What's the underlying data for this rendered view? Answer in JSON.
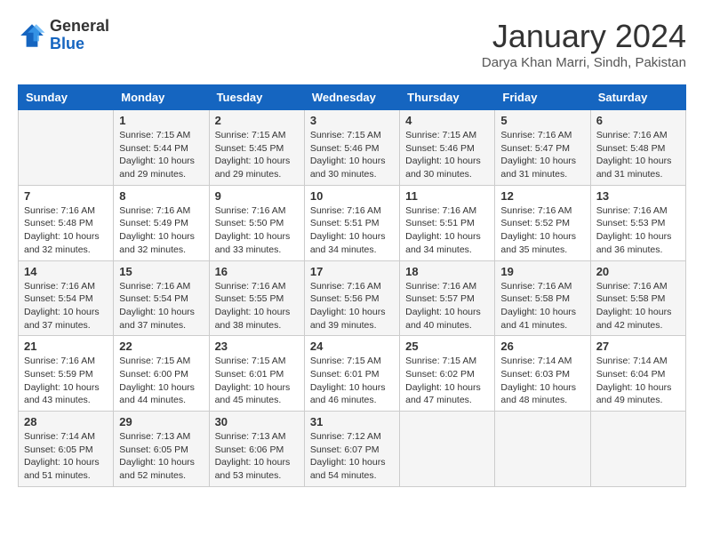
{
  "header": {
    "logo_general": "General",
    "logo_blue": "Blue",
    "month_title": "January 2024",
    "location": "Darya Khan Marri, Sindh, Pakistan"
  },
  "weekdays": [
    "Sunday",
    "Monday",
    "Tuesday",
    "Wednesday",
    "Thursday",
    "Friday",
    "Saturday"
  ],
  "weeks": [
    [
      {
        "day": "",
        "sunrise": "",
        "sunset": "",
        "daylight": ""
      },
      {
        "day": "1",
        "sunrise": "Sunrise: 7:15 AM",
        "sunset": "Sunset: 5:44 PM",
        "daylight": "Daylight: 10 hours and 29 minutes."
      },
      {
        "day": "2",
        "sunrise": "Sunrise: 7:15 AM",
        "sunset": "Sunset: 5:45 PM",
        "daylight": "Daylight: 10 hours and 29 minutes."
      },
      {
        "day": "3",
        "sunrise": "Sunrise: 7:15 AM",
        "sunset": "Sunset: 5:46 PM",
        "daylight": "Daylight: 10 hours and 30 minutes."
      },
      {
        "day": "4",
        "sunrise": "Sunrise: 7:15 AM",
        "sunset": "Sunset: 5:46 PM",
        "daylight": "Daylight: 10 hours and 30 minutes."
      },
      {
        "day": "5",
        "sunrise": "Sunrise: 7:16 AM",
        "sunset": "Sunset: 5:47 PM",
        "daylight": "Daylight: 10 hours and 31 minutes."
      },
      {
        "day": "6",
        "sunrise": "Sunrise: 7:16 AM",
        "sunset": "Sunset: 5:48 PM",
        "daylight": "Daylight: 10 hours and 31 minutes."
      }
    ],
    [
      {
        "day": "7",
        "sunrise": "Sunrise: 7:16 AM",
        "sunset": "Sunset: 5:48 PM",
        "daylight": "Daylight: 10 hours and 32 minutes."
      },
      {
        "day": "8",
        "sunrise": "Sunrise: 7:16 AM",
        "sunset": "Sunset: 5:49 PM",
        "daylight": "Daylight: 10 hours and 32 minutes."
      },
      {
        "day": "9",
        "sunrise": "Sunrise: 7:16 AM",
        "sunset": "Sunset: 5:50 PM",
        "daylight": "Daylight: 10 hours and 33 minutes."
      },
      {
        "day": "10",
        "sunrise": "Sunrise: 7:16 AM",
        "sunset": "Sunset: 5:51 PM",
        "daylight": "Daylight: 10 hours and 34 minutes."
      },
      {
        "day": "11",
        "sunrise": "Sunrise: 7:16 AM",
        "sunset": "Sunset: 5:51 PM",
        "daylight": "Daylight: 10 hours and 34 minutes."
      },
      {
        "day": "12",
        "sunrise": "Sunrise: 7:16 AM",
        "sunset": "Sunset: 5:52 PM",
        "daylight": "Daylight: 10 hours and 35 minutes."
      },
      {
        "day": "13",
        "sunrise": "Sunrise: 7:16 AM",
        "sunset": "Sunset: 5:53 PM",
        "daylight": "Daylight: 10 hours and 36 minutes."
      }
    ],
    [
      {
        "day": "14",
        "sunrise": "Sunrise: 7:16 AM",
        "sunset": "Sunset: 5:54 PM",
        "daylight": "Daylight: 10 hours and 37 minutes."
      },
      {
        "day": "15",
        "sunrise": "Sunrise: 7:16 AM",
        "sunset": "Sunset: 5:54 PM",
        "daylight": "Daylight: 10 hours and 37 minutes."
      },
      {
        "day": "16",
        "sunrise": "Sunrise: 7:16 AM",
        "sunset": "Sunset: 5:55 PM",
        "daylight": "Daylight: 10 hours and 38 minutes."
      },
      {
        "day": "17",
        "sunrise": "Sunrise: 7:16 AM",
        "sunset": "Sunset: 5:56 PM",
        "daylight": "Daylight: 10 hours and 39 minutes."
      },
      {
        "day": "18",
        "sunrise": "Sunrise: 7:16 AM",
        "sunset": "Sunset: 5:57 PM",
        "daylight": "Daylight: 10 hours and 40 minutes."
      },
      {
        "day": "19",
        "sunrise": "Sunrise: 7:16 AM",
        "sunset": "Sunset: 5:58 PM",
        "daylight": "Daylight: 10 hours and 41 minutes."
      },
      {
        "day": "20",
        "sunrise": "Sunrise: 7:16 AM",
        "sunset": "Sunset: 5:58 PM",
        "daylight": "Daylight: 10 hours and 42 minutes."
      }
    ],
    [
      {
        "day": "21",
        "sunrise": "Sunrise: 7:16 AM",
        "sunset": "Sunset: 5:59 PM",
        "daylight": "Daylight: 10 hours and 43 minutes."
      },
      {
        "day": "22",
        "sunrise": "Sunrise: 7:15 AM",
        "sunset": "Sunset: 6:00 PM",
        "daylight": "Daylight: 10 hours and 44 minutes."
      },
      {
        "day": "23",
        "sunrise": "Sunrise: 7:15 AM",
        "sunset": "Sunset: 6:01 PM",
        "daylight": "Daylight: 10 hours and 45 minutes."
      },
      {
        "day": "24",
        "sunrise": "Sunrise: 7:15 AM",
        "sunset": "Sunset: 6:01 PM",
        "daylight": "Daylight: 10 hours and 46 minutes."
      },
      {
        "day": "25",
        "sunrise": "Sunrise: 7:15 AM",
        "sunset": "Sunset: 6:02 PM",
        "daylight": "Daylight: 10 hours and 47 minutes."
      },
      {
        "day": "26",
        "sunrise": "Sunrise: 7:14 AM",
        "sunset": "Sunset: 6:03 PM",
        "daylight": "Daylight: 10 hours and 48 minutes."
      },
      {
        "day": "27",
        "sunrise": "Sunrise: 7:14 AM",
        "sunset": "Sunset: 6:04 PM",
        "daylight": "Daylight: 10 hours and 49 minutes."
      }
    ],
    [
      {
        "day": "28",
        "sunrise": "Sunrise: 7:14 AM",
        "sunset": "Sunset: 6:05 PM",
        "daylight": "Daylight: 10 hours and 51 minutes."
      },
      {
        "day": "29",
        "sunrise": "Sunrise: 7:13 AM",
        "sunset": "Sunset: 6:05 PM",
        "daylight": "Daylight: 10 hours and 52 minutes."
      },
      {
        "day": "30",
        "sunrise": "Sunrise: 7:13 AM",
        "sunset": "Sunset: 6:06 PM",
        "daylight": "Daylight: 10 hours and 53 minutes."
      },
      {
        "day": "31",
        "sunrise": "Sunrise: 7:12 AM",
        "sunset": "Sunset: 6:07 PM",
        "daylight": "Daylight: 10 hours and 54 minutes."
      },
      {
        "day": "",
        "sunrise": "",
        "sunset": "",
        "daylight": ""
      },
      {
        "day": "",
        "sunrise": "",
        "sunset": "",
        "daylight": ""
      },
      {
        "day": "",
        "sunrise": "",
        "sunset": "",
        "daylight": ""
      }
    ]
  ]
}
